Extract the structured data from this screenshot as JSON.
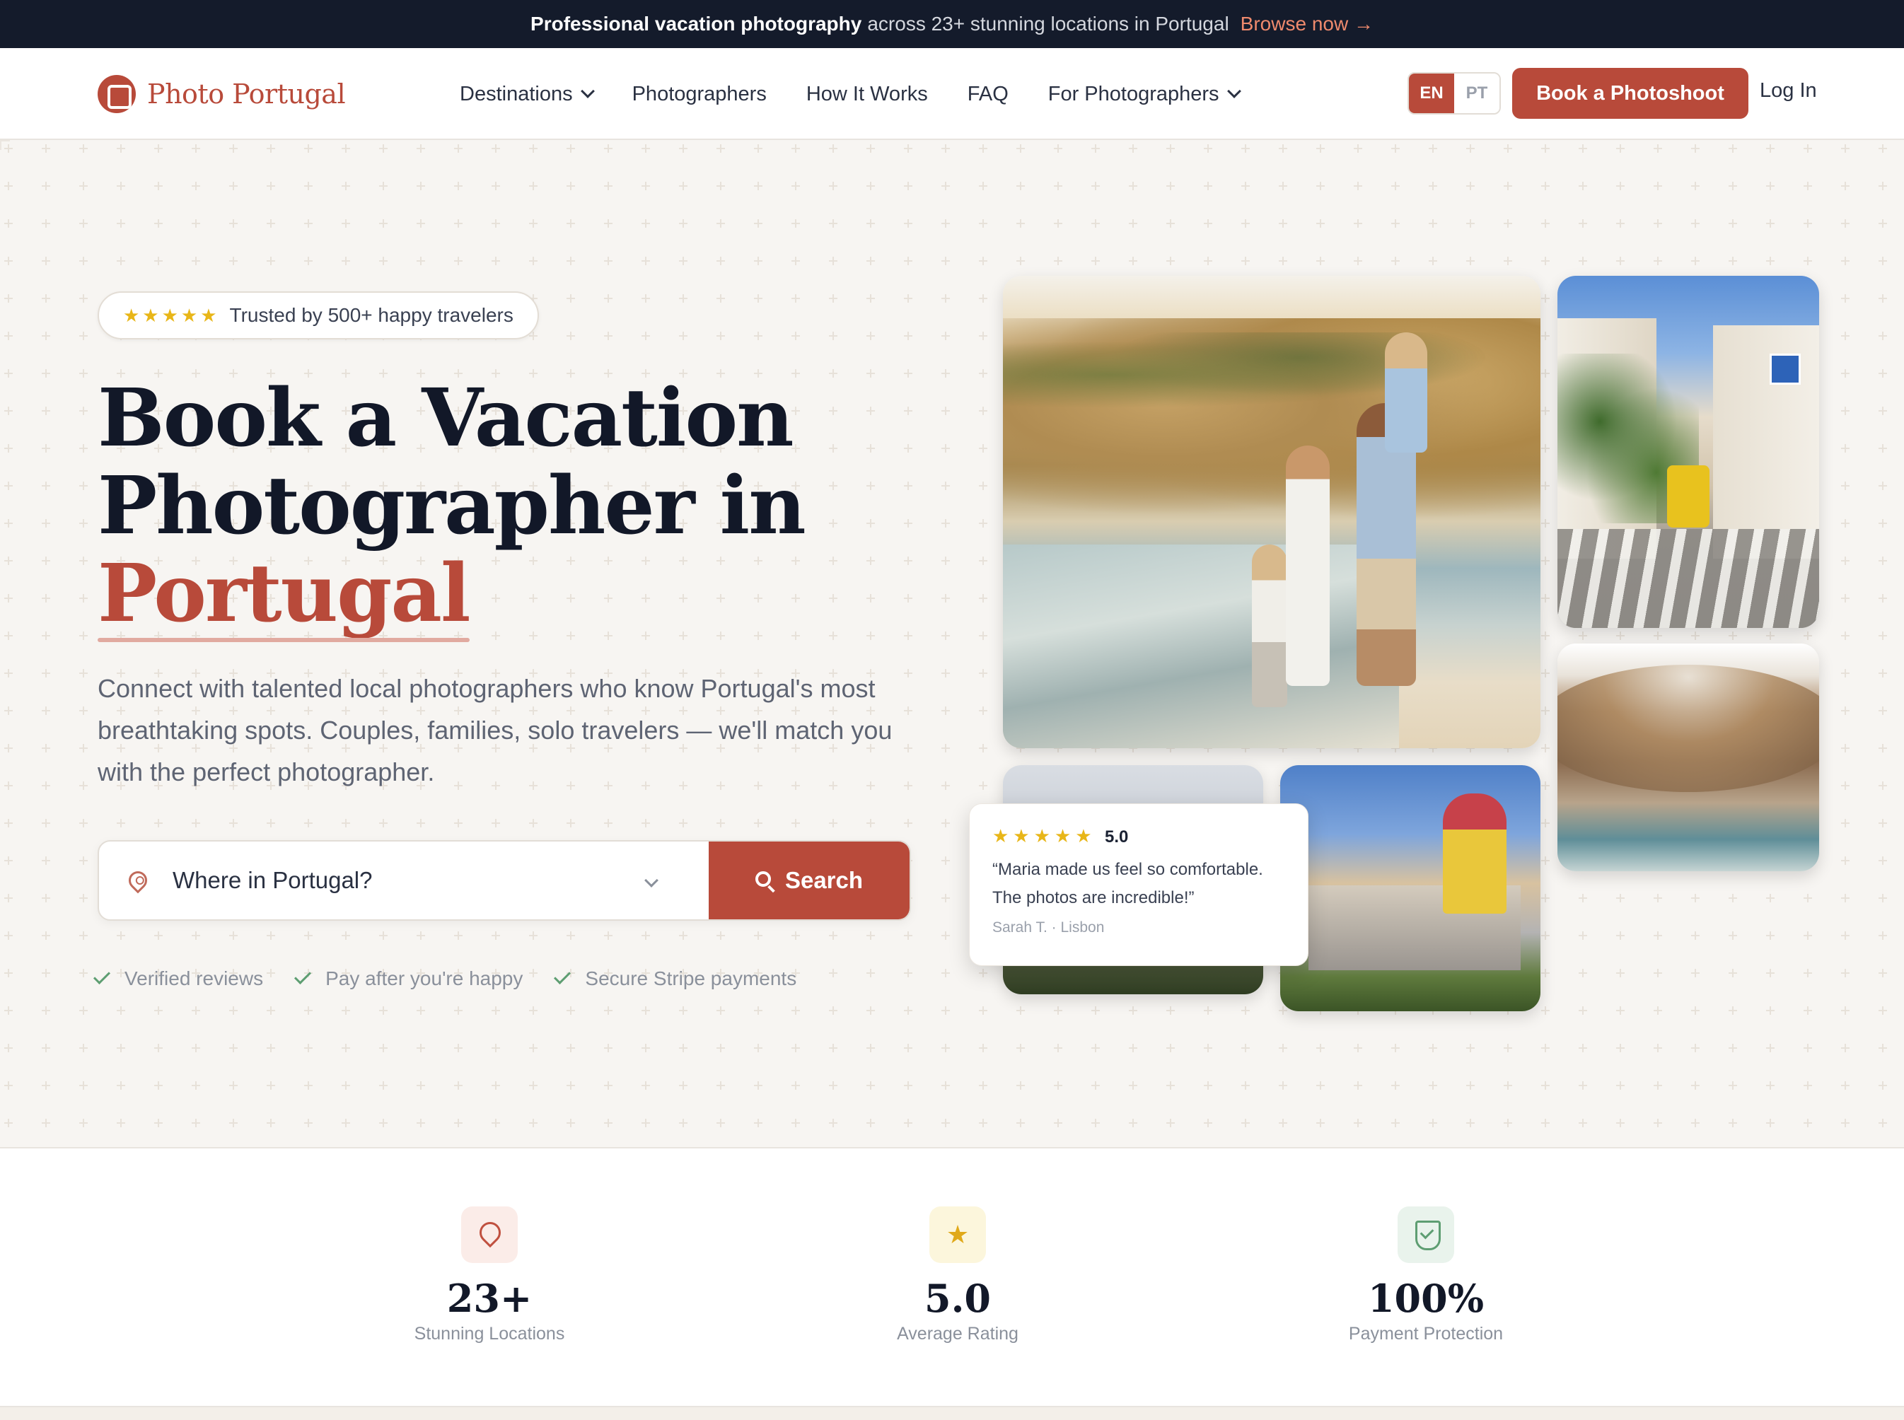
{
  "announcement": {
    "bold": "Professional vacation photography",
    "rest": "across 23+ stunning locations in Portugal",
    "link": "Browse now →"
  },
  "nav": {
    "logo": "Photo Portugal",
    "menu": [
      {
        "label": "Destinations",
        "dropdown": true
      },
      {
        "label": "Photographers",
        "dropdown": false
      },
      {
        "label": "How It Works",
        "dropdown": false
      },
      {
        "label": "FAQ",
        "dropdown": false
      },
      {
        "label": "For Photographers",
        "dropdown": true
      }
    ],
    "lang_active": "EN",
    "lang_inactive": "PT",
    "cta": "Book a Photoshoot",
    "login": "Log In"
  },
  "hero": {
    "badge_stars": "★★★★★",
    "badge_text": "Trusted by 500+ happy travelers",
    "title_line1": "Book a Vacation",
    "title_line2": "Photographer in",
    "title_accent": "Portugal",
    "subtitle": "Connect with talented local photographers who know Portugal's most breathtaking spots. Couples, families, solo travelers — we'll match you with the perfect photographer.",
    "search_placeholder": "Where in Portugal?",
    "search_button": "Search",
    "checks": [
      "Verified reviews",
      "Pay after you're happy",
      "Secure Stripe payments"
    ]
  },
  "review": {
    "stars": "★★★★★",
    "rating": "5.0",
    "quote": "“Maria made us feel so comfortable. The photos are incredible!”",
    "author": "Sarah T. · Lisbon"
  },
  "stats": [
    {
      "value": "23+",
      "label": "Stunning Locations",
      "icon": "map-pin-icon"
    },
    {
      "value": "5.0",
      "label": "Average Rating",
      "icon": "star-icon"
    },
    {
      "value": "100%",
      "label": "Payment Protection",
      "icon": "shield-check-icon"
    }
  ],
  "colors": {
    "brand": "#b84a3a",
    "dark": "#141b2b",
    "star": "#e8b618",
    "check": "#5e9e72"
  }
}
